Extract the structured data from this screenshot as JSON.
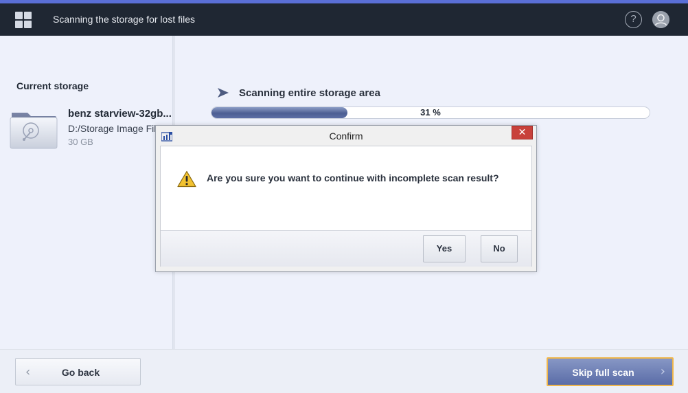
{
  "header": {
    "title": "Scanning the storage for lost files",
    "app_icon": "grid-icon",
    "help_icon": "help-icon",
    "help_glyph": "?",
    "user_icon": "user-icon"
  },
  "left_panel": {
    "section_label": "Current storage",
    "storage": {
      "icon": "drive-icon",
      "name": "benz starview-32gb...",
      "path": "D:/Storage Image File",
      "size": "30 GB"
    }
  },
  "scan": {
    "label": "Scanning entire storage area",
    "progress_percent": 31,
    "progress_text": "31 %"
  },
  "footer": {
    "back_label": "Go back",
    "back_glyph": "‹",
    "skip_label": "Skip full scan",
    "skip_glyph": "›"
  },
  "dialog": {
    "title": "Confirm",
    "close_glyph": "✕",
    "message": "Are you sure you want to continue with incomplete scan result?",
    "icon": "warning-icon",
    "yes_label": "Yes",
    "no_label": "No"
  },
  "colors": {
    "topbar": "#1f2733",
    "accent": "#5a6fd6",
    "progress_fill": "#4d5f93",
    "skip_button": "#6a7cb5",
    "skip_border": "#f0b64a",
    "close_button": "#c8413b"
  }
}
